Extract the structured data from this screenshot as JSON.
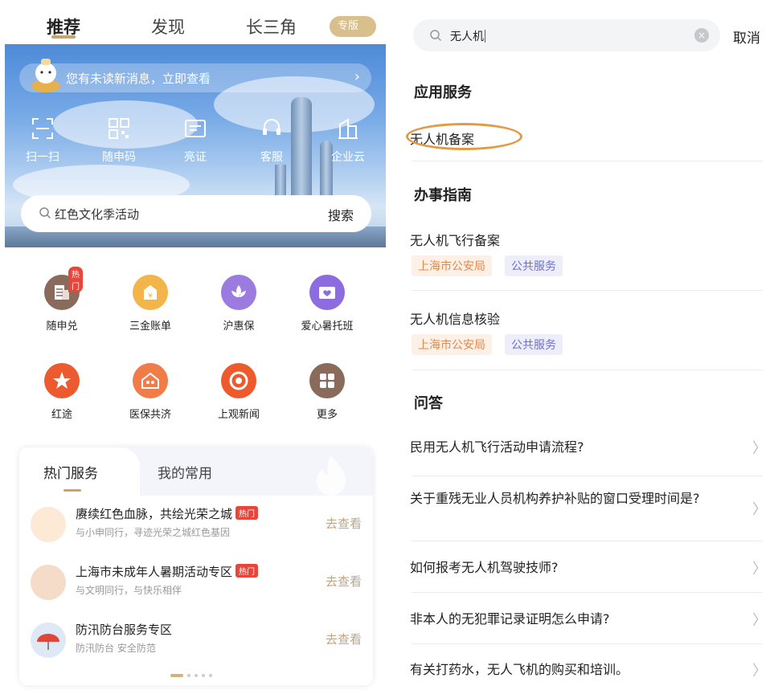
{
  "left": {
    "tabs": {
      "recommend": "推荐",
      "discover": "发现",
      "yrd": "长三角",
      "edition": "专版"
    },
    "banner": {
      "message": "您有未读新消息，立即查看",
      "quick": [
        "扫一扫",
        "随申码",
        "亮证",
        "客服",
        "企业云"
      ],
      "search_placeholder": "红色文化季活动",
      "search_button": "搜索"
    },
    "services": [
      {
        "label": "随申兑",
        "badge": "热门"
      },
      {
        "label": "三金账单"
      },
      {
        "label": "沪惠保"
      },
      {
        "label": "爱心暑托班"
      },
      {
        "label": "红途"
      },
      {
        "label": "医保共济"
      },
      {
        "label": "上观新闻"
      },
      {
        "label": "更多"
      }
    ],
    "card": {
      "tab_active": "热门服务",
      "tab_other": "我的常用",
      "rows": [
        {
          "title": "赓续红色血脉，共绘光荣之城",
          "hot": "热门",
          "sub": "与小申同行，寻迹光荣之城红色基因",
          "action": "去查看"
        },
        {
          "title": "上海市未成年人暑期活动专区",
          "hot": "热门",
          "sub": "与文明同行，与快乐相伴",
          "action": "去查看"
        },
        {
          "title": "防汛防台服务专区",
          "sub": "防汛防台 安全防范",
          "action": "去查看"
        }
      ]
    }
  },
  "right": {
    "search_value": "无人机",
    "cancel": "取消",
    "sections": {
      "apps": "应用服务",
      "guide": "办事指南",
      "qa": "问答"
    },
    "app_item": "无人机备案",
    "guides": [
      {
        "title": "无人机飞行备案",
        "tags": [
          "上海市公安局",
          "公共服务"
        ]
      },
      {
        "title": "无人机信息核验",
        "tags": [
          "上海市公安局",
          "公共服务"
        ]
      }
    ],
    "questions": [
      "民用无人机飞行活动申请流程?",
      "关于重残无业人员机构养护补贴的窗口受理时间是?",
      "如何报考无人机驾驶技师?",
      "非本人的无犯罪记录证明怎么申请?",
      "有关打药水，无人飞机的购买和培训。"
    ]
  },
  "colors": {
    "gold": "#c9a46b",
    "hot_red": "#e8463a",
    "highlight_ring": "#e39a45",
    "tag_orange": "#e2894a",
    "tag_purple": "#6e6fd0"
  }
}
